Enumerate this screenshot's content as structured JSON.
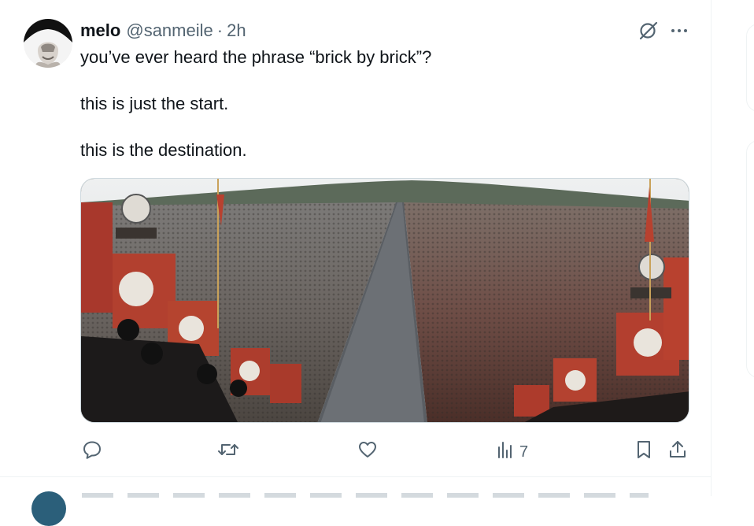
{
  "tweet": {
    "author": {
      "name": "melo",
      "handle": "@sanmeile",
      "separator": "·",
      "time": "2h"
    },
    "text_lines": [
      "you’ve ever heard the phrase “brick by brick”?",
      "this is just the start.",
      "this is the destination."
    ],
    "actions": {
      "views_count": "7"
    },
    "icons": {
      "grok": "grok-icon",
      "more": "more-icon",
      "reply": "reply-icon",
      "retweet": "retweet-icon",
      "like": "like-icon",
      "views": "views-icon",
      "bookmark": "bookmark-icon",
      "share": "share-icon"
    }
  },
  "colors": {
    "text_primary": "#0f1419",
    "text_secondary": "#536471",
    "border": "#eff3f4",
    "media_border": "#cfd9de"
  }
}
